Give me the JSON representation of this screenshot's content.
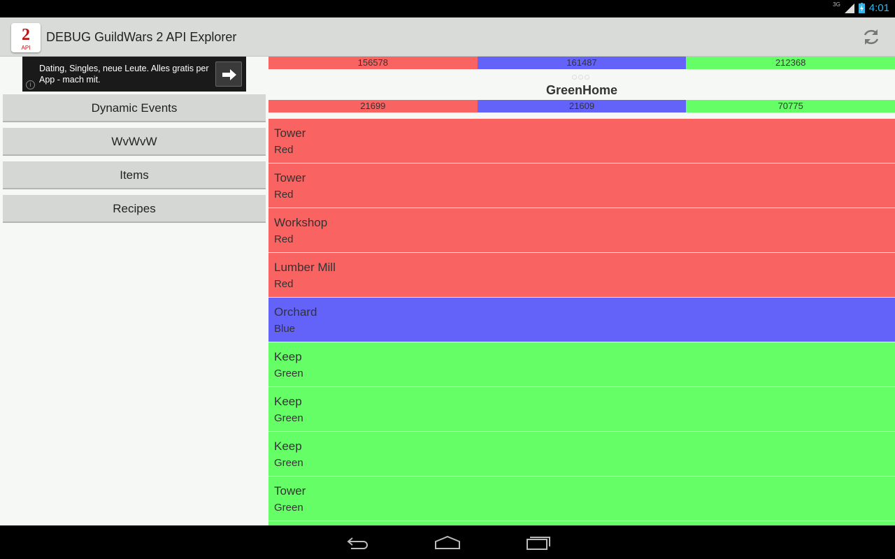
{
  "status": {
    "network": "3G",
    "time": "4:01"
  },
  "app": {
    "title": "DEBUG GuildWars 2 API Explorer",
    "icon_label": "API"
  },
  "ad": {
    "text": "Dating, Singles, neue Leute. Alles gratis per App - mach mit."
  },
  "menu": [
    {
      "label": "Dynamic Events"
    },
    {
      "label": "WvWvW"
    },
    {
      "label": "Items"
    },
    {
      "label": "Recipes"
    }
  ],
  "scores_total": {
    "red": "156578",
    "blue": "161487",
    "green": "212368"
  },
  "map": {
    "title": "GreenHome"
  },
  "scores_map": {
    "red": "21699",
    "blue": "21609",
    "green": "70775"
  },
  "objectives": [
    {
      "name": "Tower",
      "owner": "Red"
    },
    {
      "name": "Tower",
      "owner": "Red"
    },
    {
      "name": "Workshop",
      "owner": "Red"
    },
    {
      "name": "Lumber Mill",
      "owner": "Red"
    },
    {
      "name": "Orchard",
      "owner": "Blue"
    },
    {
      "name": "Keep",
      "owner": "Green"
    },
    {
      "name": "Keep",
      "owner": "Green"
    },
    {
      "name": "Keep",
      "owner": "Green"
    },
    {
      "name": "Tower",
      "owner": "Green"
    },
    {
      "name": "",
      "owner": "Green"
    }
  ],
  "colors": {
    "red": "#f96462",
    "blue": "#6363fa",
    "green": "#66fe66",
    "accent": "#33b5e5"
  },
  "icons": [
    "refresh-icon",
    "arrow-right-icon",
    "info-icon",
    "back-icon",
    "home-icon",
    "recents-icon"
  ]
}
